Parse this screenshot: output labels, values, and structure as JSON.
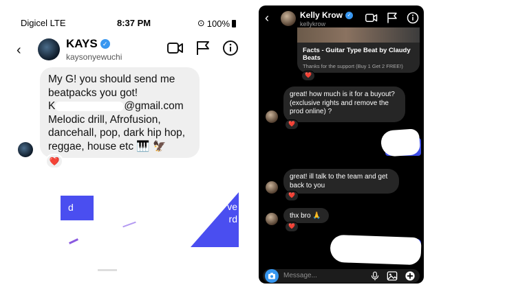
{
  "left": {
    "status": {
      "carrier": "Digicel  LTE",
      "time": "8:37 PM",
      "battery": "100%"
    },
    "header": {
      "name": "KAYS",
      "handle": "kaysonyewuchi"
    },
    "message": {
      "line1": "My G! you should send me",
      "line2": "beatpacks you got!",
      "email_prefix": "K",
      "email_suffix": "@gmail.com",
      "line4": "Melodic drill, Afrofusion,",
      "line5": "dancehall, pop, dark hip hop,",
      "line6": "reggae, house etc 🎹 🦅",
      "reaction": "❤️"
    },
    "fragments": {
      "left_letter": "d",
      "right_text_1": "ve",
      "right_text_2": "rd"
    }
  },
  "right": {
    "header": {
      "name": "Kelly Krow",
      "handle": "kellykrow"
    },
    "card": {
      "title": "Facts - Guitar Type Beat by Claudy Beats",
      "subtitle": "Thanks for the support (Buy 1 Get 2 FREE!)",
      "reaction": "❤️"
    },
    "messages": [
      {
        "text": "great! how much is it for a buyout? (exclusive rights and remove the prod online) ?",
        "reaction": "❤️"
      },
      {
        "text": "great! ill talk to the team and get back to you",
        "reaction": "❤️"
      },
      {
        "text": "thx bro 🙏",
        "reaction": "❤️"
      }
    ],
    "composer": {
      "placeholder": "Message..."
    }
  },
  "colors": {
    "verified": "#3897f0",
    "accent_blue": "#4a4ef0",
    "dark_bg": "#000000",
    "bubble_dark": "#262626",
    "bubble_light": "#efefef"
  }
}
